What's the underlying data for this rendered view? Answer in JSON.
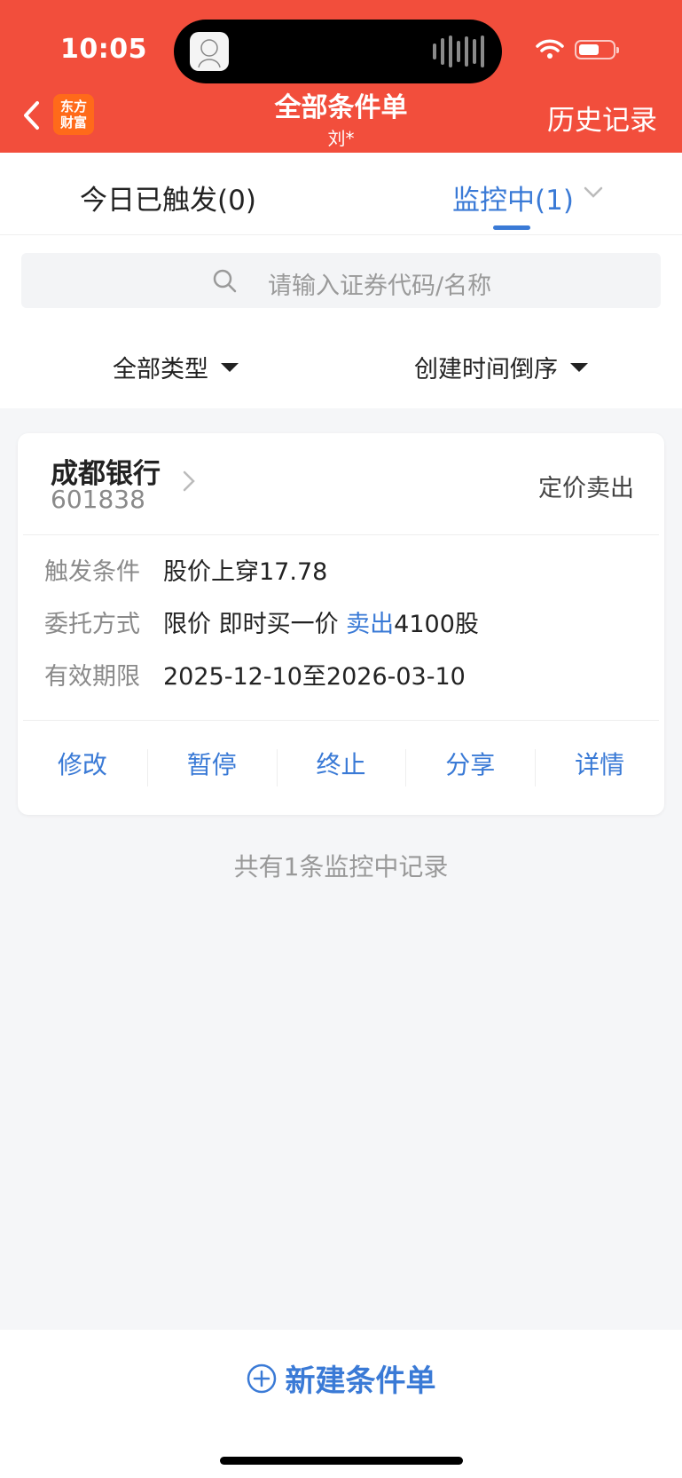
{
  "status_bar": {
    "time": "10:05"
  },
  "header": {
    "logo_line1": "东方",
    "logo_line2": "财富",
    "title": "全部条件单",
    "subtitle": "刘*",
    "history_label": "历史记录"
  },
  "tabs": [
    {
      "label": "今日已触发(0)",
      "active": false
    },
    {
      "label": "监控中(1)",
      "active": true
    }
  ],
  "search": {
    "placeholder": "请输入证券代码/名称"
  },
  "filters": {
    "type_label": "全部类型",
    "sort_label": "创建时间倒序"
  },
  "card": {
    "stock_name": "成都银行",
    "stock_code": "601838",
    "order_type": "定价卖出",
    "rows": [
      {
        "label": "触发条件",
        "value": "股价上穿17.78"
      },
      {
        "label": "委托方式",
        "value_prefix": "限价 即时买一价 ",
        "value_highlight": "卖出",
        "value_suffix": "4100股"
      },
      {
        "label": "有效期限",
        "value": "2025-12-10至2026-03-10"
      }
    ],
    "actions": [
      "修改",
      "暂停",
      "终止",
      "分享",
      "详情"
    ]
  },
  "footer_note": "共有1条监控中记录",
  "bottom": {
    "new_order_label": "新建条件单"
  },
  "colors": {
    "header_bg": "#f24e3c",
    "accent_blue": "#3a7ad6",
    "logo_bg": "#ff6a1a"
  }
}
